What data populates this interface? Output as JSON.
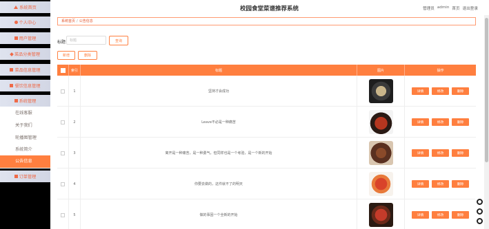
{
  "app": {
    "title": "校园食堂菜谱推荐系统"
  },
  "header": {
    "role": "管理员",
    "username": "admin",
    "home": "首页",
    "logout": "退出登录"
  },
  "sidebar": {
    "items": [
      {
        "label": "系统首页",
        "icon": "home-icon"
      },
      {
        "label": "个人中心",
        "icon": "person-icon"
      },
      {
        "label": "用户管理",
        "icon": "user-icon"
      },
      {
        "label": "菜品分类管理",
        "icon": "tag-icon"
      },
      {
        "label": "菜品信息管理",
        "icon": "dish-icon"
      },
      {
        "label": "餐饮信息管理",
        "icon": "meal-icon"
      },
      {
        "label": "系统管理",
        "icon": "system-icon"
      }
    ],
    "submenu": [
      {
        "label": "在线客服"
      },
      {
        "label": "关于我们"
      },
      {
        "label": "轮播图管理"
      },
      {
        "label": "系统简介"
      },
      {
        "label": "公告信息"
      }
    ],
    "after": {
      "label": "订单管理",
      "icon": "order-icon"
    }
  },
  "breadcrumb": {
    "home": "系统首页",
    "current": "公告信息"
  },
  "search": {
    "label": "标题",
    "placeholder": "标题",
    "button": "查询"
  },
  "actions": {
    "add": "新增",
    "delete": "删除"
  },
  "table": {
    "headers": {
      "index": "索引",
      "title": "标题",
      "image": "图片",
      "operations": "操作"
    },
    "row_buttons": {
      "detail": "详情",
      "edit": "修改",
      "delete": "删除"
    },
    "rows": [
      {
        "index": "1",
        "title": "坚持才会成功",
        "image": "bowl-dish-image"
      },
      {
        "index": "2",
        "title": "Leave不必是一种痛苦",
        "image": "stew-pot-image"
      },
      {
        "index": "3",
        "title": "离开是一种痛苦，是一种勇气，但同样也是一个考验，是一个新的开始",
        "image": "bbq-plate-image"
      },
      {
        "index": "4",
        "title": "你要去做的，这件就不了的明天",
        "image": "shrimp-plate-image"
      },
      {
        "index": "5",
        "title": "做的事因一个全新的开始",
        "image": "seafood-plate-image"
      }
    ]
  },
  "colors": {
    "accent": "#ff7f3f",
    "sidebar_bg": "#000000",
    "menu_bg": "#dfe3ef",
    "menu_text": "#ef6a48"
  }
}
